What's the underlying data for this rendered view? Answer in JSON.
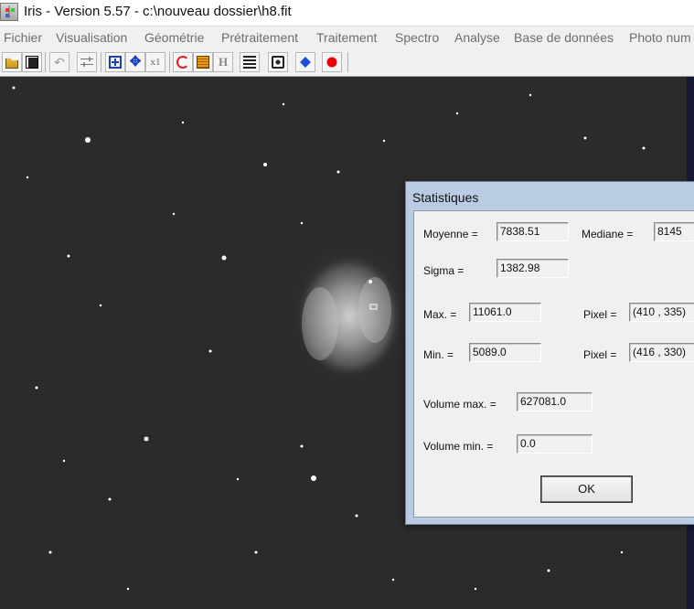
{
  "window": {
    "title": "Iris - Version 5.57 - c:\\nouveau dossier\\h8.fit"
  },
  "menu": [
    "Fichier",
    "Visualisation",
    "Géométrie",
    "Prétraitement",
    "Traitement",
    "Spectro",
    "Analyse",
    "Base de données",
    "Photo num"
  ],
  "toolbar": {
    "buttons": [
      {
        "name": "open-folder-icon"
      },
      {
        "name": "save-icon"
      },
      {
        "name": "undo-icon"
      },
      {
        "name": "threshold-sliders-icon"
      },
      {
        "name": "zoom-fit-icon"
      },
      {
        "name": "move-arrows-icon"
      },
      {
        "name": "x1-zoom-icon"
      },
      {
        "name": "red-swirl-icon"
      },
      {
        "name": "orange-palette-icon"
      },
      {
        "name": "histogram-h-icon"
      },
      {
        "name": "list-icon"
      },
      {
        "name": "camera-icon"
      },
      {
        "name": "blue-diamond-icon"
      },
      {
        "name": "red-dot-icon"
      }
    ],
    "x1_label": "x1",
    "h_label": "H"
  },
  "dialog": {
    "title": "Statistiques",
    "moyenne_label": "Moyenne =",
    "moyenne_value": "7838.51",
    "mediane_label": "Mediane =",
    "mediane_value": "8145",
    "sigma_label": "Sigma =",
    "sigma_value": "1382.98",
    "max_label": "Max. =",
    "max_value": "11061.0",
    "pixel_max_label": "Pixel =",
    "pixel_max_value": "(410 , 335)",
    "min_label": "Min. =",
    "min_value": "5089.0",
    "pixel_min_label": "Pixel =",
    "pixel_min_value": "(416 , 330)",
    "volume_max_label": "Volume max. =",
    "volume_max_value": "627081.0",
    "volume_min_label": "Volume min. =",
    "volume_min_value": "0.0",
    "ok_label": "OK"
  }
}
